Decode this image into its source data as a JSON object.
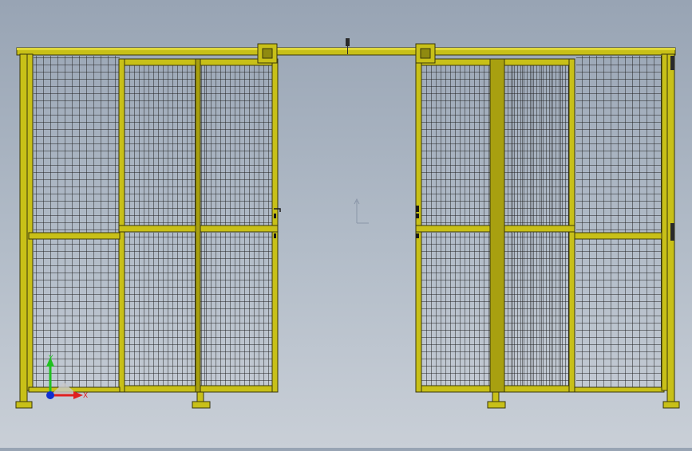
{
  "viewport": {
    "background_top": "#98a4b4",
    "background_bottom": "#c9cfd7",
    "frame_color": "#c8c018",
    "frame_outline": "#38360a",
    "mesh_color": "#202020"
  },
  "triad": {
    "x_label": "X",
    "y_label": "Y",
    "x_color": "#e02020",
    "y_color": "#20c020",
    "z_color": "#1030d0"
  },
  "icons": {
    "origin_marker": "origin-marker-icon",
    "door_handle": "door-handle-icon",
    "sensor": "sensor-icon"
  }
}
